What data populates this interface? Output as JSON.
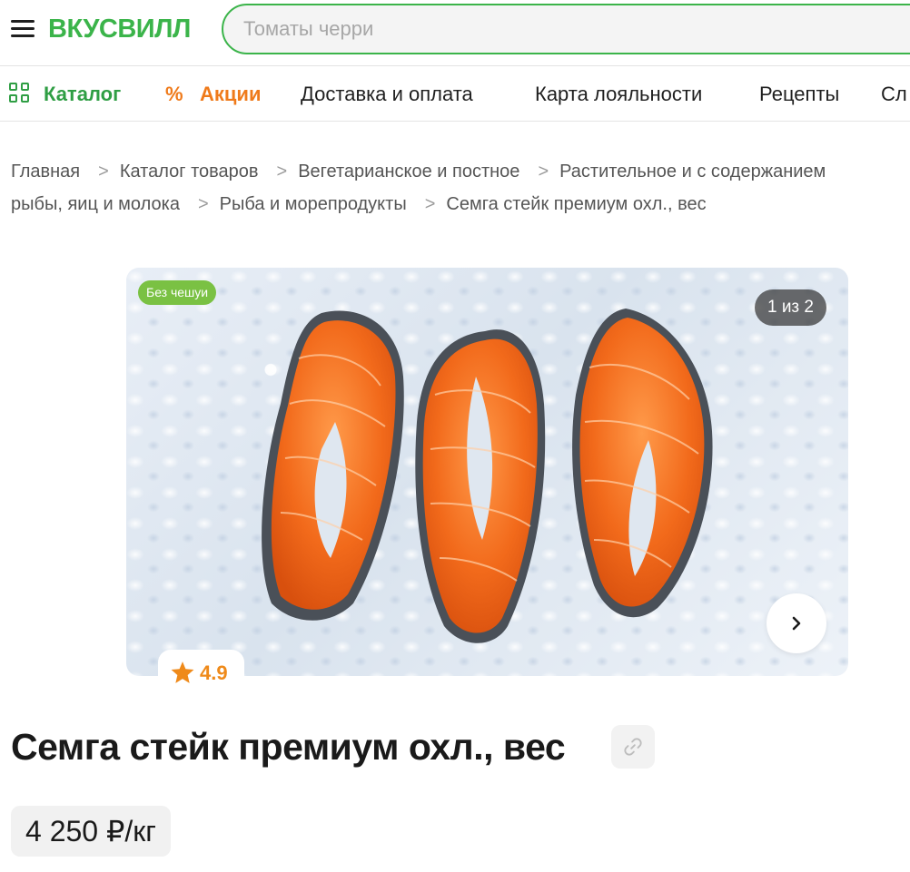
{
  "header": {
    "logo": "ВКУСВИЛЛ",
    "search_placeholder": "Томаты черри"
  },
  "nav": {
    "catalog": "Каталог",
    "sales": "Акции",
    "sales_symbol": "%",
    "items": [
      "Доставка и оплата",
      "Карта лояльности",
      "Рецепты",
      "Сл"
    ]
  },
  "breadcrumbs": {
    "line1": [
      "Главная",
      "Каталог товаров",
      "Вегетарианское и постное",
      "Растительное и с содержанием"
    ],
    "line2": [
      "рыбы, яиц и молока",
      "Рыба и морепродукты",
      "Семга стейк премиум охл., вес"
    ],
    "separator": ">"
  },
  "gallery": {
    "badge": "Без чешуи",
    "counter": "1 из 2",
    "rating": "4.9"
  },
  "product": {
    "title": "Семга стейк премиум охл., вес",
    "price": "4 250 ₽/кг"
  },
  "colors": {
    "brand_green": "#3bb44a",
    "sale_orange": "#ef7a1a",
    "badge_green": "#7ac143",
    "rating_orange": "#ef8a1a"
  }
}
